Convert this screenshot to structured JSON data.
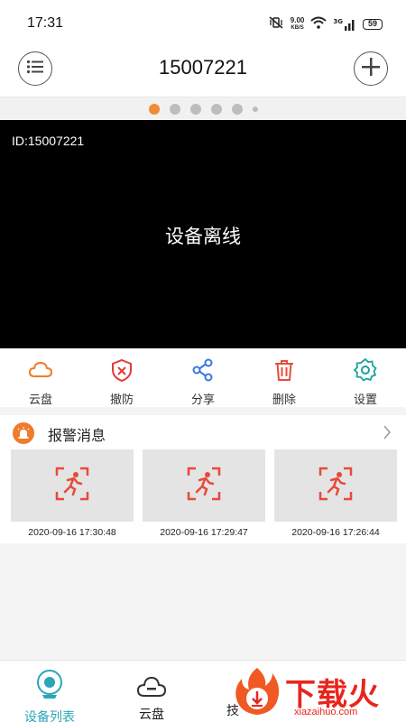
{
  "status_bar": {
    "time": "17:31",
    "net_speed": "9.00",
    "net_unit": "KB/S",
    "signal": "3G",
    "battery": "59"
  },
  "header": {
    "title": "15007221",
    "menu_icon": "list-icon",
    "add_icon": "plus-icon"
  },
  "pager": {
    "pages": 6,
    "active_index": 0
  },
  "video": {
    "device_id": "ID:15007221",
    "status": "设备离线"
  },
  "toolbar": {
    "items": [
      {
        "label": "云盘",
        "icon": "cloud-icon",
        "color": "#f07b2c"
      },
      {
        "label": "撤防",
        "icon": "shield-x-icon",
        "color": "#e53935"
      },
      {
        "label": "分享",
        "icon": "share-icon",
        "color": "#3a78e0"
      },
      {
        "label": "删除",
        "icon": "trash-icon",
        "color": "#e74c3c"
      },
      {
        "label": "设置",
        "icon": "gear-icon",
        "color": "#1aa39a"
      }
    ]
  },
  "alarm": {
    "title": "报警消息",
    "items": [
      {
        "timestamp": "2020-09-16 17:30:48",
        "icon": "motion-detect-icon"
      },
      {
        "timestamp": "2020-09-16 17:29:47",
        "icon": "motion-detect-icon"
      },
      {
        "timestamp": "2020-09-16 17:26:44",
        "icon": "motion-detect-icon"
      }
    ]
  },
  "bottom_nav": {
    "items": [
      {
        "label": "设备列表",
        "icon": "camera-icon",
        "active": true
      },
      {
        "label": "云盘",
        "icon": "cloud-icon",
        "active": false
      },
      {
        "label": "技",
        "icon": "tech-icon",
        "active": false
      }
    ]
  },
  "watermark": {
    "text": "下载火",
    "url": "xiazaihuo.com"
  },
  "colors": {
    "accent": "#f08c35",
    "active_nav": "#2aa6b8",
    "video_bg": "#000000"
  }
}
